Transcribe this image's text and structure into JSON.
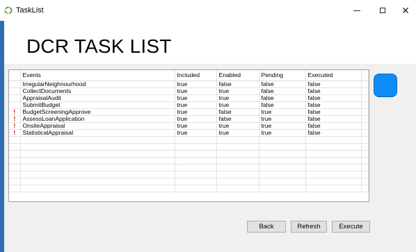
{
  "window": {
    "title": "TaskList",
    "minimize_label": "—",
    "maximize_label": "☐",
    "close_label": "✕"
  },
  "page": {
    "title": "DCR TASK LIST"
  },
  "table": {
    "columns": [
      "",
      "Events",
      "Included",
      "Enabled",
      "Pending",
      "Executed"
    ],
    "rows": [
      {
        "flag": "",
        "event": "IrregularNeighnourhood",
        "included": "true",
        "enabled": "false",
        "pending": "false",
        "executed": "false"
      },
      {
        "flag": "",
        "event": "CollectDocuments",
        "included": "true",
        "enabled": "true",
        "pending": "false",
        "executed": "false"
      },
      {
        "flag": "",
        "event": "AppraisalAudit",
        "included": "true",
        "enabled": "true",
        "pending": "false",
        "executed": "false"
      },
      {
        "flag": "",
        "event": "SubmitBudget",
        "included": "true",
        "enabled": "true",
        "pending": "false",
        "executed": "false"
      },
      {
        "flag": "!",
        "event": "BudgetScreeningApprove",
        "included": "true",
        "enabled": "false",
        "pending": "true",
        "executed": "false"
      },
      {
        "flag": "!",
        "event": "AssessLoanApplication",
        "included": "true",
        "enabled": "false",
        "pending": "true",
        "executed": "false"
      },
      {
        "flag": "!",
        "event": "OnsiteAppraisal",
        "included": "true",
        "enabled": "true",
        "pending": "true",
        "executed": "false"
      },
      {
        "flag": "!",
        "event": "StatisticalAppraisal",
        "included": "true",
        "enabled": "true",
        "pending": "true",
        "executed": "false"
      }
    ],
    "empty_rows": 8
  },
  "buttons": {
    "back": "Back",
    "refresh": "Refresh",
    "execute": "Execute"
  },
  "colors": {
    "accent_button": "#0f8bf5",
    "flag": "#d00000",
    "window_border": "#2e6fb1"
  }
}
